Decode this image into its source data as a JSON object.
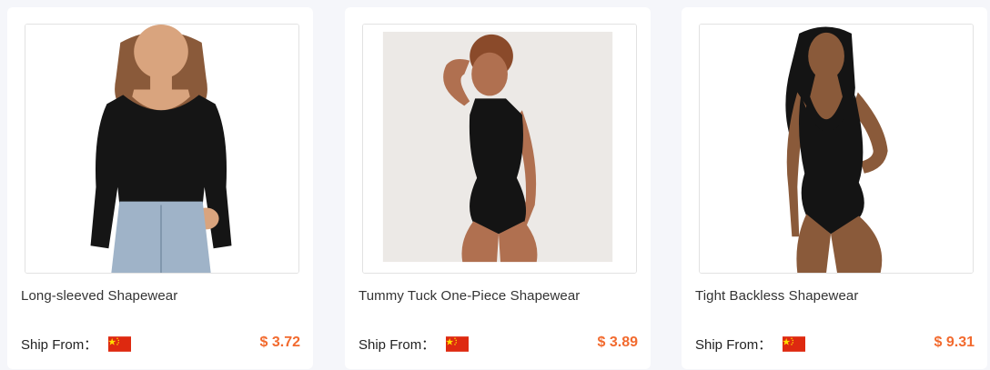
{
  "products": [
    {
      "title": "Long-sleeved Shapewear",
      "ship_label": "Ship From：",
      "ship_country": "China",
      "price": "$ 3.72",
      "image_alt": "Woman wearing black long-sleeved scoop-neck bodysuit with jeans"
    },
    {
      "title": "Tummy Tuck One-Piece Shapewear",
      "ship_label": "Ship From：",
      "ship_country": "China",
      "price": "$ 3.89",
      "image_alt": "Woman wearing black sleeveless high-neck bodysuit"
    },
    {
      "title": "Tight Backless Shapewear",
      "ship_label": "Ship From：",
      "ship_country": "China",
      "price": "$ 9.31",
      "image_alt": "Woman wearing black deep-plunge backless bodysuit"
    }
  ],
  "colors": {
    "price": "#f26a2e",
    "flag_red": "#de2910",
    "flag_star": "#ffde00"
  },
  "icons": {
    "flag": "china-flag-icon"
  }
}
